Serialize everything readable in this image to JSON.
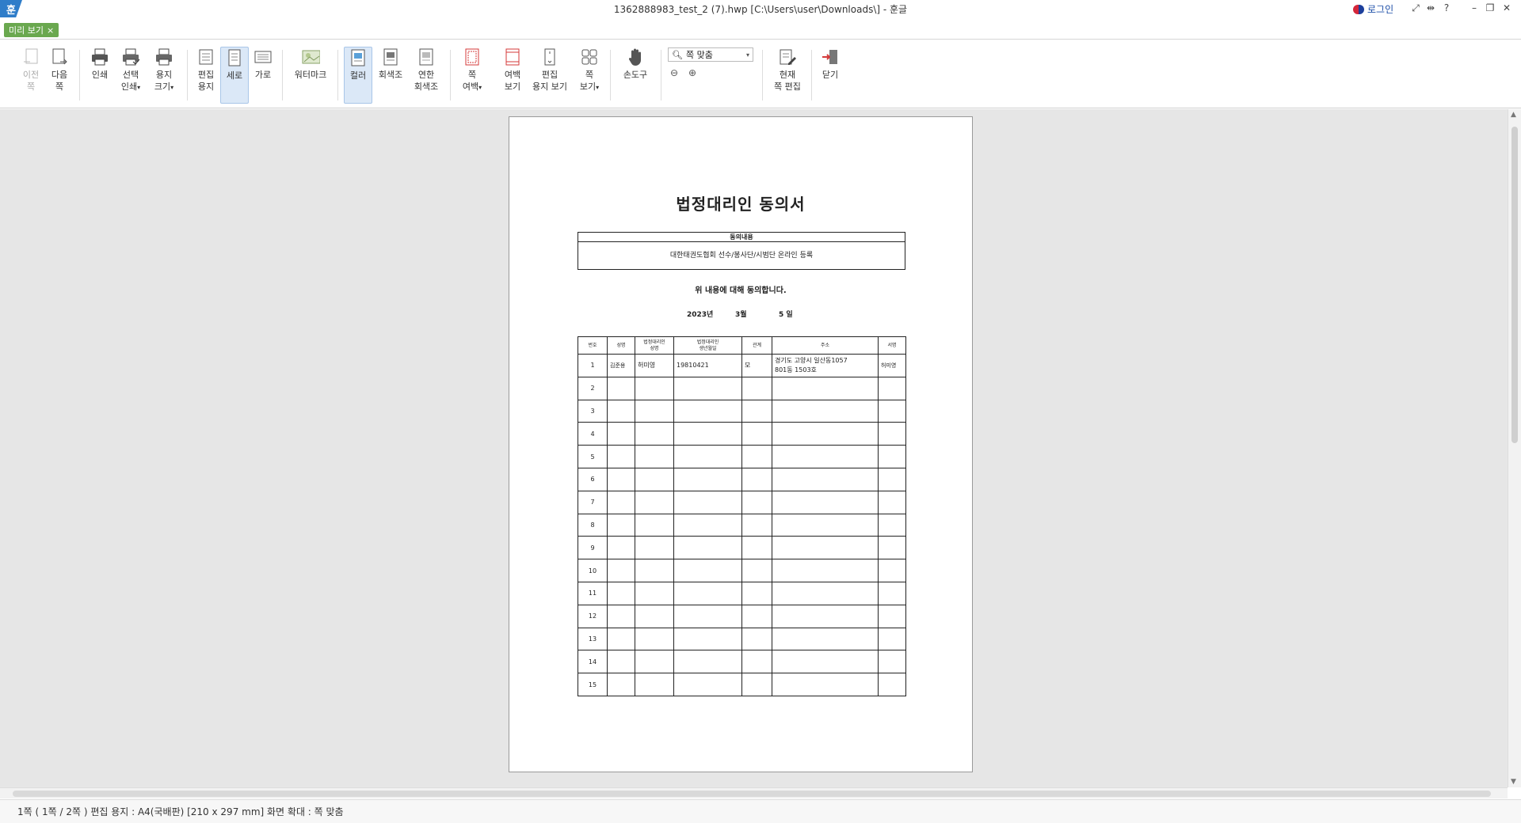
{
  "window": {
    "logo": "훈",
    "title": "1362888983_test_2 (7).hwp [C:\\Users\\user\\Downloads\\] - 훈글",
    "login": "로그인",
    "help": "?"
  },
  "tab": {
    "label": "미리 보기",
    "close": "×"
  },
  "ribbon": {
    "prev_page": [
      "이전",
      "쪽"
    ],
    "next_page": [
      "다음",
      "쪽"
    ],
    "print": "인쇄",
    "select_print": [
      "선택",
      "인쇄"
    ],
    "paper_size": [
      "용지",
      "크기"
    ],
    "edit_paper": [
      "편집",
      "용지"
    ],
    "portrait": "세로",
    "landscape": "가로",
    "watermark": "워터마크",
    "color": "컬러",
    "grayscale": "회색조",
    "light_grayscale": [
      "연한",
      "회색조"
    ],
    "page_margin": [
      "쪽",
      "여백"
    ],
    "margin_view": [
      "여백",
      "보기"
    ],
    "edit_paper_view": [
      "편집",
      "용지 보기"
    ],
    "page_view": [
      "쪽",
      "보기"
    ],
    "hand_tool": "손도구",
    "zoom_value": "쪽 맞춤",
    "current_page_edit": [
      "현재",
      "쪽 편집"
    ],
    "close": "닫기"
  },
  "document": {
    "title": "법정대리인 동의서",
    "consent_header": "동의내용",
    "consent_text": "대한태권도협회 선수/봉사단/시범단 온라인 등록",
    "agree_line": "위 내용에 대해 동의합니다.",
    "date": {
      "year": "2023년",
      "month": "3월",
      "day": "5 일"
    },
    "table_headers": [
      "번호",
      "성명",
      "법정대리인\n성명",
      "법정대리인\n생년월일",
      "관계",
      "주소",
      "서명"
    ],
    "rows": [
      [
        "1",
        "김준용",
        "허미영",
        "19810421",
        "모",
        "경기도 고양시 일산동1057\n801동 1503호",
        "허미영"
      ],
      [
        "2",
        "",
        "",
        "",
        "",
        "",
        ""
      ],
      [
        "3",
        "",
        "",
        "",
        "",
        "",
        ""
      ],
      [
        "4",
        "",
        "",
        "",
        "",
        "",
        ""
      ],
      [
        "5",
        "",
        "",
        "",
        "",
        "",
        ""
      ],
      [
        "6",
        "",
        "",
        "",
        "",
        "",
        ""
      ],
      [
        "7",
        "",
        "",
        "",
        "",
        "",
        ""
      ],
      [
        "8",
        "",
        "",
        "",
        "",
        "",
        ""
      ],
      [
        "9",
        "",
        "",
        "",
        "",
        "",
        ""
      ],
      [
        "10",
        "",
        "",
        "",
        "",
        "",
        ""
      ],
      [
        "11",
        "",
        "",
        "",
        "",
        "",
        ""
      ],
      [
        "12",
        "",
        "",
        "",
        "",
        "",
        ""
      ],
      [
        "13",
        "",
        "",
        "",
        "",
        "",
        ""
      ],
      [
        "14",
        "",
        "",
        "",
        "",
        "",
        ""
      ],
      [
        "15",
        "",
        "",
        "",
        "",
        "",
        ""
      ]
    ]
  },
  "status": "1쪽 ( 1쪽 / 2쪽 ) 편집 용지 : A4(국배판)  [210 x 297 mm]  화면 확대 : 쪽 맞춤",
  "colors": {
    "tab_green": "#6aa84f",
    "active_blue": "#dbe8f7",
    "logo_blue": "#2f7dc9",
    "accent_red": "#d43a3a"
  }
}
